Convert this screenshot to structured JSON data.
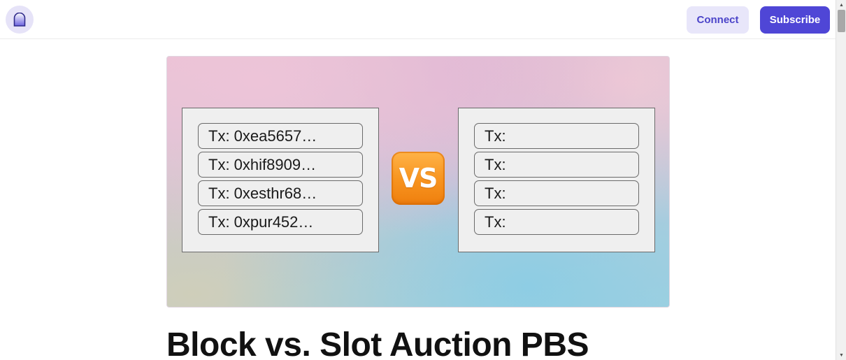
{
  "header": {
    "logo_icon": "publication-logo-icon",
    "connect_label": "Connect",
    "subscribe_label": "Subscribe"
  },
  "hero": {
    "left_panel": {
      "rows": [
        "Tx: 0xea5657…",
        "Tx: 0xhif8909…",
        "Tx: 0xesthr68…",
        "Tx: 0xpur452…"
      ]
    },
    "vs_label": "VS",
    "right_panel": {
      "rows": [
        "Tx:",
        "Tx:",
        "Tx:",
        "Tx:"
      ]
    }
  },
  "article": {
    "title": "Block vs. Slot Auction PBS"
  },
  "colors": {
    "accent": "#4f46d6",
    "accent_light": "#e8e6fa",
    "vs_orange": "#f7931e"
  }
}
